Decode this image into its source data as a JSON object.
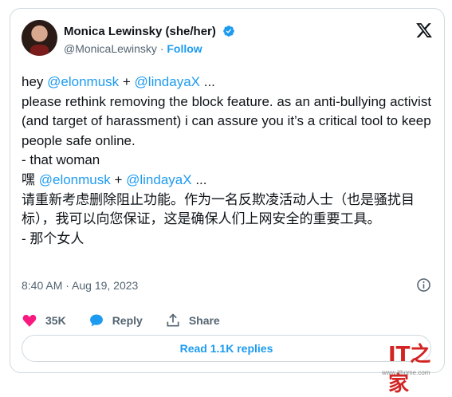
{
  "tweet": {
    "author_name": "Monica Lewinsky (she/her)",
    "author_handle": "@MonicaLewinsky",
    "separator": " · ",
    "follow_label": "Follow",
    "en_greeting": "hey ",
    "en_mention1": "@elonmusk",
    "en_plus": " + ",
    "en_mention2": "@lindayaX",
    "en_ellipsis": " ...",
    "en_body": "please rethink removing the block feature. as an anti-bullying activist (and target of harassment) i can assure you it’s a critical tool to keep people safe online.\n- that woman",
    "zh_greeting": "嘿 ",
    "zh_mention1": "@elonmusk",
    "zh_plus": " + ",
    "zh_mention2": "@lindayaX",
    "zh_ellipsis": " ...",
    "zh_body": "请重新考虑删除阻止功能。作为一名反欺凌活动人士（也是骚扰目标），我可以向您保证，这是确保人们上网安全的重要工具。\n- 那个女人",
    "timestamp": "8:40 AM · Aug 19, 2023"
  },
  "actions": {
    "likes": "35K",
    "reply_label": "Reply",
    "share_label": "Share"
  },
  "read_replies_label": "Read 1.1K replies",
  "watermark": {
    "logo": "IT之家",
    "site": "www.ithome.com"
  },
  "colors": {
    "accent": "#1d9bf0",
    "like": "#f91880",
    "text": "#0f1419",
    "muted": "#536471"
  }
}
